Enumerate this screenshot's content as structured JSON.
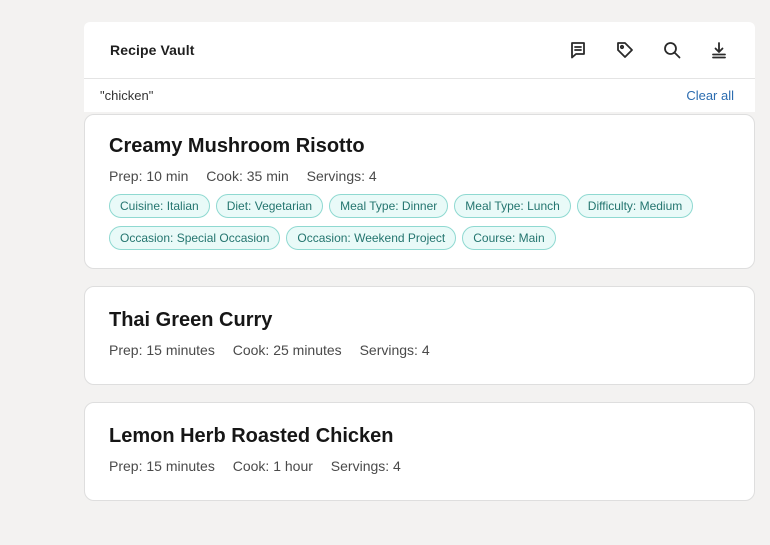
{
  "header": {
    "title": "Recipe Vault",
    "actions": [
      {
        "name": "notes-icon"
      },
      {
        "name": "tag-icon"
      },
      {
        "name": "search-icon"
      },
      {
        "name": "download-icon"
      }
    ]
  },
  "filter": {
    "query": "\"chicken\"",
    "clear_label": "Clear all"
  },
  "recipes": [
    {
      "title": "Creamy Mushroom Risotto",
      "prep": "Prep: 10 min",
      "cook": "Cook: 35 min",
      "servings": "Servings: 4",
      "tags": [
        "Cuisine: Italian",
        "Diet: Vegetarian",
        "Meal Type: Dinner",
        "Meal Type: Lunch",
        "Difficulty: Medium",
        "Occasion: Special Occasion",
        "Occasion: Weekend Project",
        "Course: Main"
      ]
    },
    {
      "title": "Thai Green Curry",
      "prep": "Prep: 15 minutes",
      "cook": "Cook: 25 minutes",
      "servings": "Servings: 4",
      "tags": []
    },
    {
      "title": "Lemon Herb Roasted Chicken",
      "prep": "Prep: 15 minutes",
      "cook": "Cook: 1 hour",
      "servings": "Servings: 4",
      "tags": []
    }
  ],
  "colors": {
    "background": "#f3f2f1",
    "tag_text": "#24756f",
    "tag_bg": "#e9faf8",
    "tag_border": "#8fd9d1",
    "link": "#2b6cb0"
  }
}
